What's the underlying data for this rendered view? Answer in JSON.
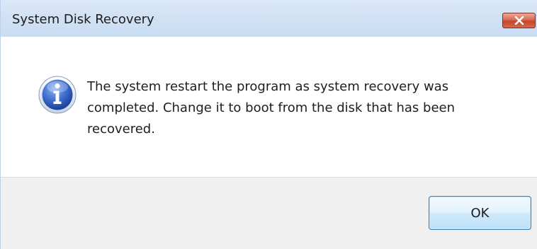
{
  "window": {
    "title": "System Disk Recovery"
  },
  "dialog": {
    "icon": "info-icon",
    "message": "The system restart the program as system recovery was completed. Change it to boot from the disk that has been recovered."
  },
  "buttons": {
    "ok_label": "OK"
  },
  "colors": {
    "titlebar": "#d0e1f4",
    "close_button": "#c6452a",
    "footer": "#f0f0f0",
    "ok_border": "#3c7fb1"
  }
}
